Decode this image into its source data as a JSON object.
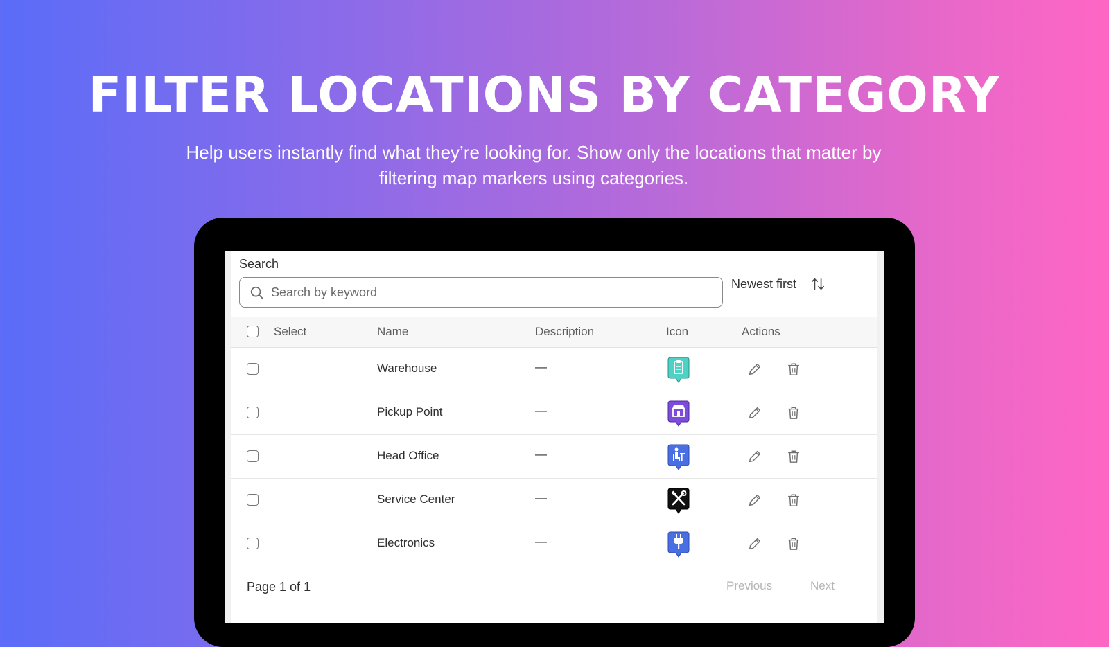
{
  "hero": {
    "title": "FILTER LOCATIONS BY CATEGORY",
    "subtitle": "Help users instantly find what they’re looking for. Show only the locations that matter by filtering map markers using categories."
  },
  "search": {
    "label": "Search",
    "placeholder": "Search by keyword"
  },
  "sort": {
    "label": "Newest first"
  },
  "table": {
    "headers": {
      "select": "Select",
      "name": "Name",
      "description": "Description",
      "icon": "Icon",
      "actions": "Actions"
    },
    "rows": [
      {
        "name": "Warehouse",
        "description": "—",
        "icon": "clipboard-marker-icon",
        "color": "#4fd1c5"
      },
      {
        "name": "Pickup Point",
        "description": "—",
        "icon": "store-marker-icon",
        "color": "#7c4ddb"
      },
      {
        "name": "Head Office",
        "description": "—",
        "icon": "office-desk-marker-icon",
        "color": "#4a6fe3"
      },
      {
        "name": "Service Center",
        "description": "—",
        "icon": "tools-marker-icon",
        "color": "#111111"
      },
      {
        "name": "Electronics",
        "description": "—",
        "icon": "plug-marker-icon",
        "color": "#4a6fe3"
      }
    ]
  },
  "pagination": {
    "label": "Page 1 of 1",
    "previous": "Previous",
    "next": "Next"
  }
}
